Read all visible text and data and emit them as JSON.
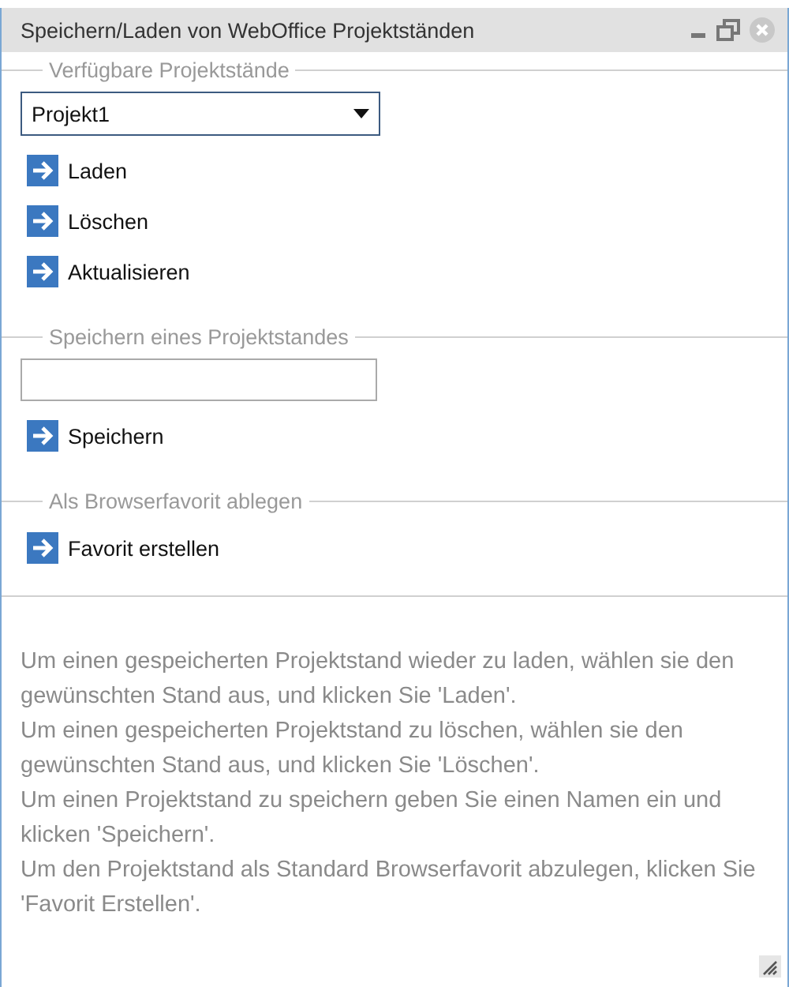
{
  "window": {
    "title": "Speichern/Laden von WebOffice Projektständen"
  },
  "sections": [
    {
      "legend": "Verfügbare Projektstände",
      "dropdown": {
        "value": "Projekt1"
      },
      "actions": [
        "Laden",
        "Löschen",
        "Aktualisieren"
      ]
    },
    {
      "legend": "Speichern eines Projektstandes",
      "field": {
        "kind": "text"
      },
      "actions": [
        "Speichern"
      ]
    },
    {
      "legend": "Als Browserfavorit ablegen",
      "actions": [
        "Favorit erstellen"
      ]
    }
  ],
  "help": [
    "Um einen gespeicherten Projektstand wieder zu laden, wählen sie den gewünschten Stand aus, und klicken Sie 'Laden'.",
    "Um einen gespeicherten Projektstand zu löschen, wählen sie den gewünschten Stand aus, und klicken Sie 'Löschen'.",
    "Um einen Projektstand zu speichern geben Sie einen Namen ein und klicken 'Speichern'.",
    "Um den Projektstand als Standard Browserfavorit abzulegen, klicken Sie 'Favorit Erstellen'."
  ]
}
